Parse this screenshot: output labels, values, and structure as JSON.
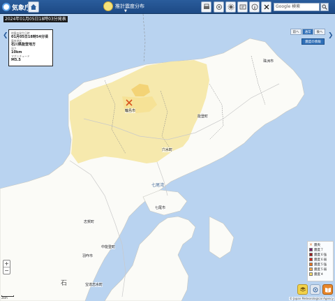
{
  "header": {
    "logo_text": "気象庁",
    "mode_label": "推計震度分布",
    "search_placeholder": "Google 検索"
  },
  "icons": [
    "home-icon",
    "print-icon",
    "share-icon",
    "settings-icon",
    "help-icon",
    "x-logo-icon",
    "search-icon"
  ],
  "banner": {
    "date": "2024年01月05日18時03分発表"
  },
  "info_card": {
    "time_label": "地震の発生日時",
    "time_value": "01月05日18時54分頃",
    "region_label": "震央地名",
    "region_value": "石川県能登地方",
    "depth_label": "深さ",
    "depth_value": "10km",
    "mag_label": "マグニチュード",
    "mag_value": "M5.5"
  },
  "right_panel": {
    "btn_prev": "前へ",
    "btn_current": "通常",
    "btn_next": "後へ",
    "btn_info": "震度の情報"
  },
  "map_labels": {
    "wajima": "輪島市",
    "suzu": "珠洲市",
    "noto_town": "能登町",
    "anamizu": "穴水町",
    "nanao_bay": "七尾湾",
    "nanao": "七尾市",
    "shika": "志賀町",
    "hakui": "羽咋市",
    "nakanoto": "中能登町",
    "hodatsushimizu": "宝達志水町",
    "ishikawa_char": "石"
  },
  "zoom": {
    "plus": "+",
    "minus": "−"
  },
  "legend": {
    "items": [
      {
        "label": "震央",
        "color": "#e07020"
      },
      {
        "label": "震度７",
        "color": "#7a1f6b"
      },
      {
        "label": "震度６強",
        "color": "#9b1c1c"
      },
      {
        "label": "震度６弱",
        "color": "#d02a1e"
      },
      {
        "label": "震度５強",
        "color": "#e6731f"
      },
      {
        "label": "震度５弱",
        "color": "#f2a54a"
      },
      {
        "label": "震度４",
        "color": "#f5d96b"
      }
    ]
  },
  "credit": "© Japan Meteorological Agency",
  "scale_label": "2km"
}
